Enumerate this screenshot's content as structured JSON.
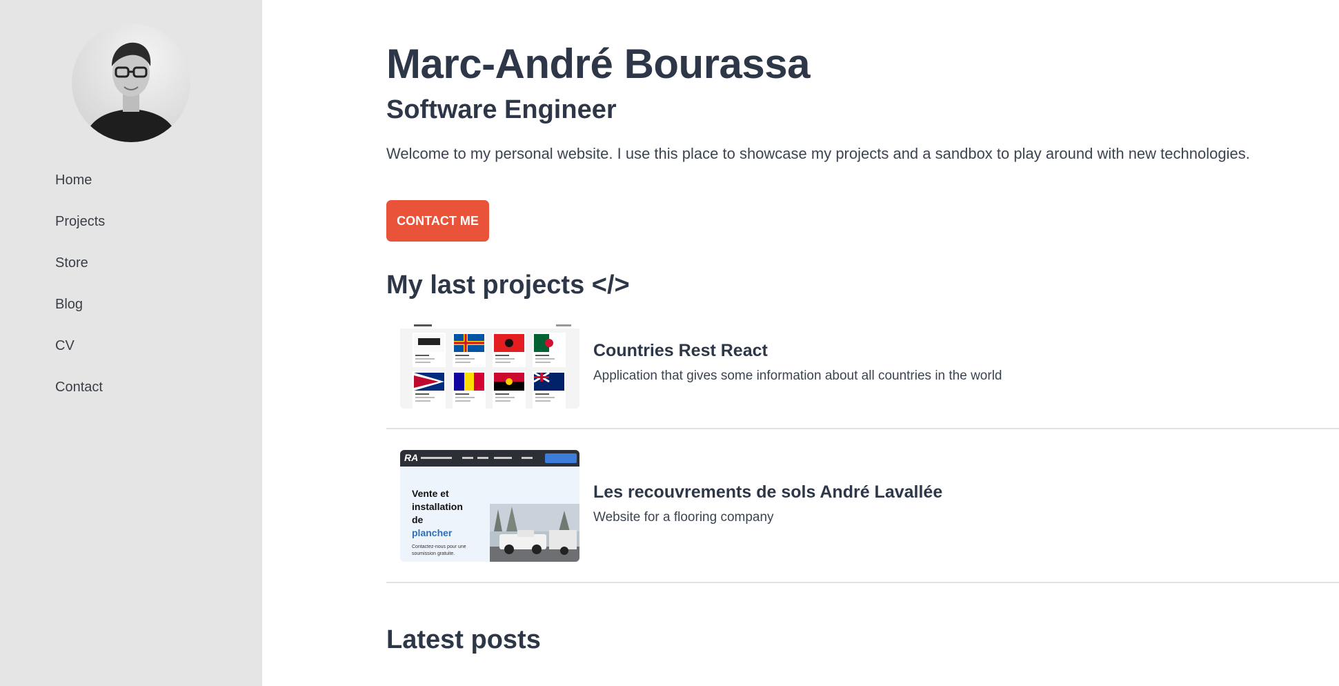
{
  "sidebar": {
    "avatar_alt": "Profile photo",
    "nav": [
      {
        "label": "Home"
      },
      {
        "label": "Projects"
      },
      {
        "label": "Store"
      },
      {
        "label": "Blog"
      },
      {
        "label": "CV"
      },
      {
        "label": "Contact"
      }
    ]
  },
  "hero": {
    "name": "Marc-André Bourassa",
    "role": "Software Engineer",
    "intro": "Welcome to my personal website. I use this place to showcase my projects and a sandbox to play around with new technologies.",
    "contact_label": "CONTACT ME"
  },
  "projects": {
    "title": "My last projects </>",
    "items": [
      {
        "title": "Countries Rest React",
        "description": "Application that gives some information about all countries in the world"
      },
      {
        "title": "Les recouvrements de sols André Lavallée",
        "description": "Website for a flooring company",
        "thumb": {
          "heading_line1": "Vente et",
          "heading_line2": "installation",
          "heading_line3": "de",
          "heading_line4": "plancher",
          "subtext_line1": "Contactez-nous pour une",
          "subtext_line2": "soumission gratuite."
        }
      }
    ]
  },
  "posts": {
    "title": "Latest posts"
  },
  "colors": {
    "accent": "#e8533a",
    "sidebar_bg": "#e5e5e5",
    "text": "#2d3748"
  }
}
